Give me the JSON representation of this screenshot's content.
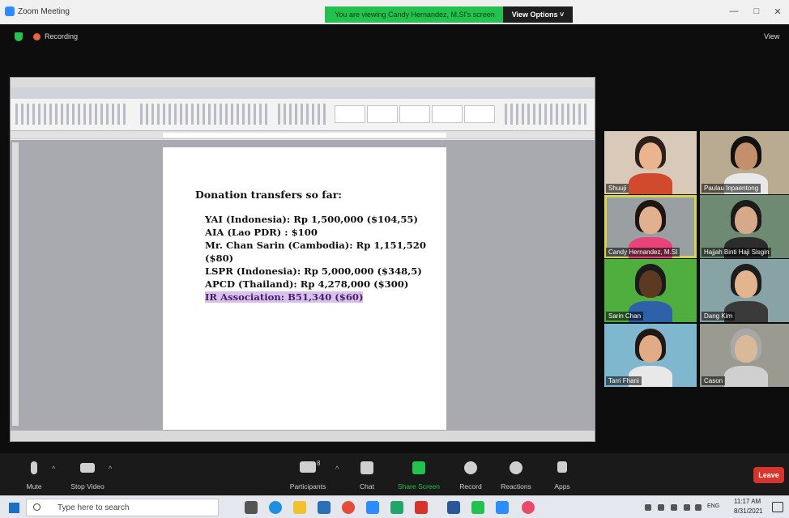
{
  "window": {
    "title": "Zoom Meeting",
    "share_banner": "You are viewing Candy Hernandez, M.SI's screen",
    "view_options": "View Options ˅",
    "controls": [
      "—",
      "□",
      "✕"
    ]
  },
  "recording": {
    "label": "Recording",
    "view_label": "View"
  },
  "document": {
    "heading": "Donation transfers so far:",
    "lines": [
      "YAI (Indonesia): Rp 1,500,000 ($104,55)",
      "AIA (Lao PDR) : $100",
      "Mr. Chan Sarin (Cambodia): Rp 1,151,520",
      "($80)",
      "LSPR (Indonesia): Rp 5,000,000 ($348,5)",
      "APCD (Thailand): Rp 4,278,000 ($300)",
      "IR Association: B51,340 ($60)"
    ],
    "highlighted_index": 6
  },
  "participants": [
    {
      "name": "Shuuji",
      "bg": "#d8c9b8",
      "skin": "#e9b48e",
      "hair": "#2a1f1a",
      "shirt": "#d24a2e"
    },
    {
      "name": "Paulau Inpaentong",
      "bg": "#b9aa92",
      "skin": "#c48f6b",
      "hair": "#111",
      "shirt": "#e8e8e8"
    },
    {
      "name": "Candy Hernandez, M.SI",
      "bg": "#9aa0a2",
      "skin": "#e0b08f",
      "hair": "#1e1512",
      "shirt": "#e8447a",
      "active": true
    },
    {
      "name": "Hajjah Binti Haji Sisgin",
      "bg": "#6f8a72",
      "skin": "#d5a98a",
      "hair": "#1b1b1b",
      "shirt": "#2c2c2c"
    },
    {
      "name": "Sarin Chan",
      "bg": "#4fae3e",
      "skin": "#5c3a22",
      "hair": "#1b1b1b",
      "shirt": "#2d62a8"
    },
    {
      "name": "Dang Kim",
      "bg": "#87a3a6",
      "skin": "#e2b58f",
      "hair": "#1d1d1d",
      "shirt": "#3a3a3a"
    },
    {
      "name": "Tarri Fhani",
      "bg": "#7fb7cf",
      "skin": "#dfac86",
      "hair": "#201814",
      "shirt": "#e8e8e8"
    },
    {
      "name": "Cason",
      "bg": "#9a9a90",
      "skin": "#d9b99a",
      "hair": "#a8a8a8",
      "shirt": "#cfcfcf"
    }
  ],
  "toolbar": {
    "items": [
      "Mute",
      "Stop Video",
      "Participants",
      "Chat",
      "Share Screen",
      "Record",
      "Reactions",
      "Apps"
    ],
    "participants_count": "8",
    "leave": "Leave"
  },
  "taskbar": {
    "search_placeholder": "Type here to search",
    "lang": "ENG",
    "time": "11:17 AM",
    "date": "8/31/2021"
  },
  "colors": {
    "share_banner": "#23c24e",
    "leave": "#d9342b",
    "highlight": "#d7c3ea",
    "active_speaker": "#d7d34a"
  }
}
